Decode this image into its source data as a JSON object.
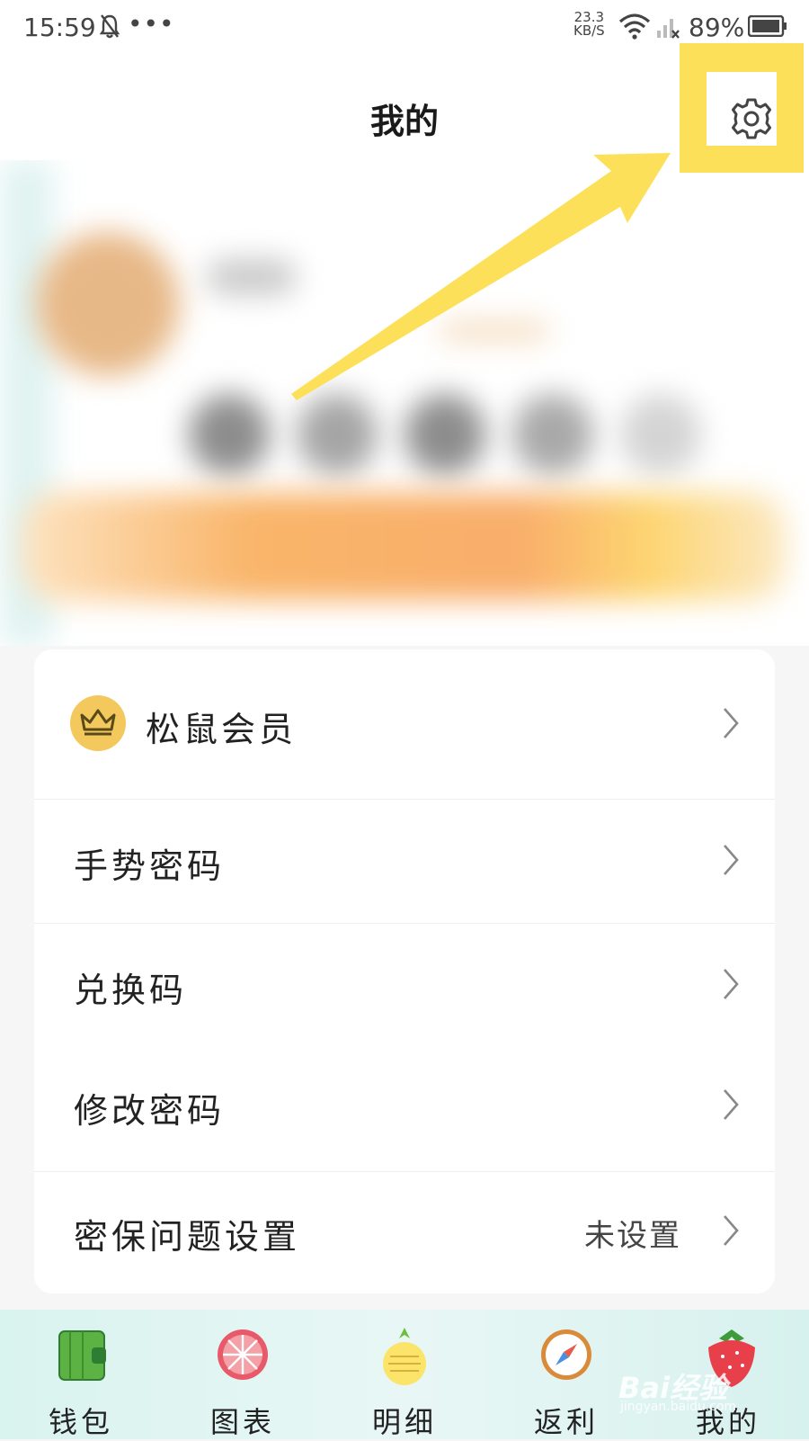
{
  "status_bar": {
    "time": "15:59",
    "dots": "•••",
    "speed_value": "23.3",
    "speed_unit": "KB/S",
    "battery": "89%"
  },
  "header": {
    "title": "我的"
  },
  "menu": {
    "items": [
      {
        "label": "松鼠会员",
        "value": ""
      },
      {
        "label": "手势密码",
        "value": ""
      },
      {
        "label": "兑换码",
        "value": ""
      },
      {
        "label": "修改密码",
        "value": ""
      },
      {
        "label": "密保问题设置",
        "value": "未设置"
      }
    ]
  },
  "tabbar": {
    "tabs": [
      {
        "label": "钱包",
        "icon": "wallet-icon"
      },
      {
        "label": "图表",
        "icon": "chart-icon"
      },
      {
        "label": "明细",
        "icon": "pineapple-icon"
      },
      {
        "label": "返利",
        "icon": "compass-icon"
      },
      {
        "label": "我的",
        "icon": "strawberry-icon"
      }
    ]
  },
  "watermark": {
    "main": "Bai经验",
    "sub": "jingyan.baidu.com"
  },
  "colors": {
    "highlight": "#fde05a",
    "arrow": "#fde05a",
    "crown_badge": "#f3c85d"
  }
}
